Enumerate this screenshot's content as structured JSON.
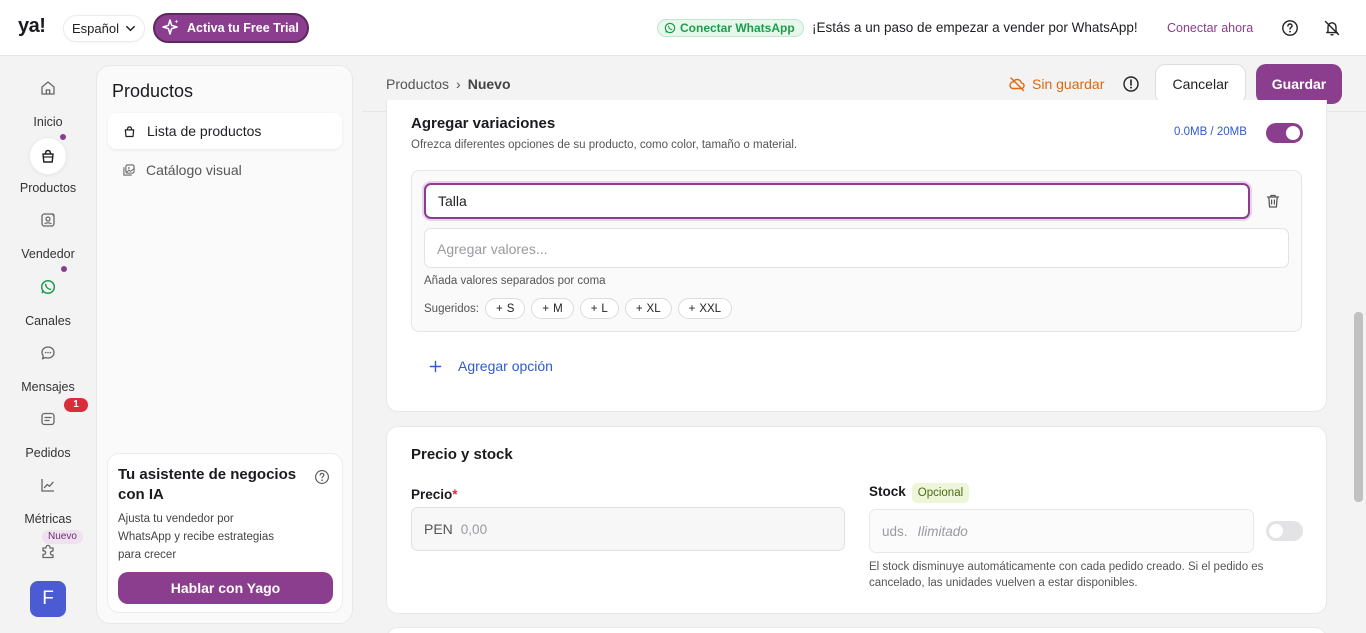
{
  "topbar": {
    "logo": "ya!",
    "language": "Español",
    "trial_label": "Activa tu Free Trial",
    "whatsapp_pill": "Conectar WhatsApp",
    "whatsapp_message": "¡Estás a un paso de empezar a vender por WhatsApp!",
    "whatsapp_link": "Conectar ahora"
  },
  "rail": {
    "items": [
      {
        "label": "Inicio",
        "icon": "home-icon"
      },
      {
        "label": "Productos",
        "icon": "bag-icon"
      },
      {
        "label": "Vendedor",
        "icon": "seller-icon"
      },
      {
        "label": "Canales",
        "icon": "whatsapp-icon"
      },
      {
        "label": "Mensajes",
        "icon": "chat-icon"
      },
      {
        "label": "Pedidos",
        "icon": "orders-icon"
      },
      {
        "label": "Métricas",
        "icon": "chart-icon"
      }
    ],
    "orders_badge": "1",
    "new_badge": "Nuevo",
    "avatar_initial": "F"
  },
  "subsidebar": {
    "title": "Productos",
    "items": [
      {
        "label": "Lista de productos"
      },
      {
        "label": "Catálogo visual"
      }
    ],
    "assistant": {
      "title": "Tu asistente de negocios con IA",
      "body": "Ajusta tu vendedor por WhatsApp y recibe estrategias para crecer",
      "button": "Hablar con Yago"
    }
  },
  "header": {
    "breadcrumb_root": "Productos",
    "breadcrumb_sep": "›",
    "breadcrumb_current": "Nuevo",
    "unsaved": "Sin guardar",
    "cancel": "Cancelar",
    "save": "Guardar"
  },
  "variations": {
    "title": "Agregar variaciones",
    "subtitle": "Ofrezca diferentes opciones de su producto, como color, tamaño o material.",
    "storage": "0.0MB / 20MB",
    "enabled": true,
    "option_value": "Talla",
    "values_placeholder": "Agregar valores...",
    "hint": "Añada valores separados por coma",
    "suggested_label": "Sugeridos:",
    "suggestions": [
      "S",
      "M",
      "L",
      "XL",
      "XXL"
    ],
    "add_option": "Agregar opción"
  },
  "price_stock": {
    "title": "Precio y stock",
    "price_label": "Precio",
    "required_mark": "*",
    "currency": "PEN",
    "price_placeholder": "0,00",
    "stock_label": "Stock",
    "optional_tag": "Opcional",
    "stock_unit": "uds.",
    "stock_placeholder": "Ilimitado",
    "stock_toggle_on": false,
    "stock_note": "El stock disminuye automáticamente con cada pedido creado. Si el pedido es cancelado, las unidades vuelven a estar disponibles."
  },
  "colors": {
    "brand": "#8a3e8d",
    "link": "#2f5bd3",
    "warning": "#e0670f",
    "whatsapp": "#1e9c4b",
    "danger": "#d92d3a"
  }
}
